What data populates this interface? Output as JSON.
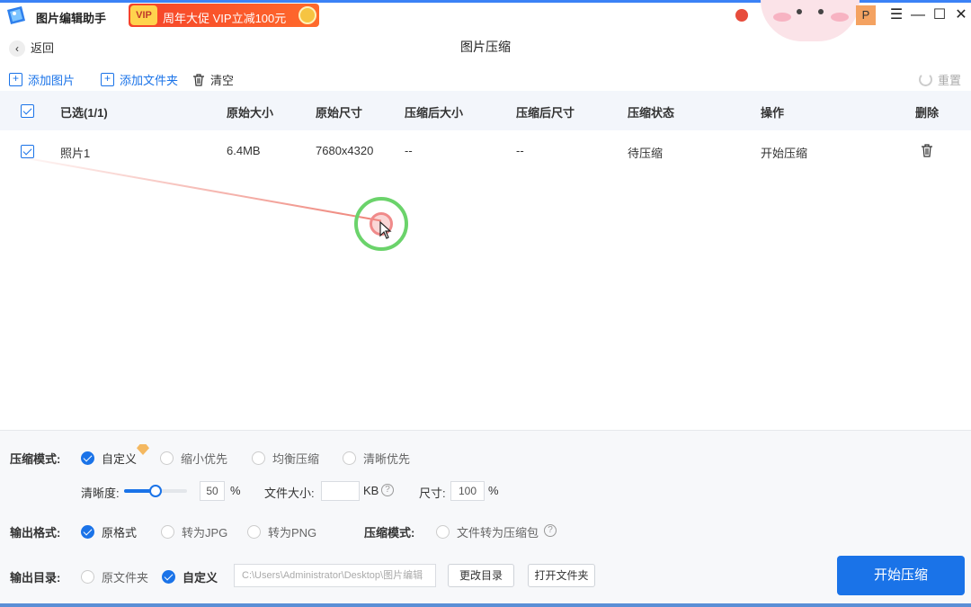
{
  "app": {
    "name": "图片编辑助手",
    "promo_badge": "VIP",
    "promo_text": "周年大促 VIP立减100元",
    "p_badge": "P"
  },
  "window_controls": {
    "menu": "☰",
    "minimize": "—",
    "maximize": "☐",
    "close": "✕"
  },
  "nav": {
    "back_label": "返回",
    "page_title": "图片压缩"
  },
  "toolbar": {
    "add_image": "添加图片",
    "add_folder": "添加文件夹",
    "clear": "清空",
    "reset": "重置"
  },
  "table": {
    "headers": {
      "selected": "已选(1/1)",
      "orig_size": "原始大小",
      "orig_dim": "原始尺寸",
      "comp_size": "压缩后大小",
      "comp_dim": "压缩后尺寸",
      "status": "压缩状态",
      "action": "操作",
      "delete": "删除"
    },
    "rows": [
      {
        "name": "照片1",
        "orig_size": "6.4MB",
        "orig_dim": "7680x4320",
        "comp_size": "--",
        "comp_dim": "--",
        "status": "待压缩",
        "action": "开始压缩"
      }
    ]
  },
  "settings": {
    "mode_label": "压缩模式:",
    "mode_options": [
      "自定义",
      "缩小优先",
      "均衡压缩",
      "清晰优先"
    ],
    "clarity_label": "清晰度:",
    "clarity_value": "50",
    "clarity_fraction": 0.5,
    "percent": "%",
    "filesize_label": "文件大小:",
    "filesize_value": "",
    "filesize_unit": "KB",
    "dim_label": "尺寸:",
    "dim_value": "100",
    "format_label": "输出格式:",
    "format_options": [
      "原格式",
      "转为JPG",
      "转为PNG"
    ],
    "mode2_label": "压缩模式:",
    "mode2_option": "文件转为压缩包",
    "output_label": "输出目录:",
    "output_options": [
      "原文件夹",
      "自定义"
    ],
    "output_path": "C:\\Users\\Administrator\\Desktop\\图片编辑",
    "change_dir": "更改目录",
    "open_folder": "打开文件夹",
    "start": "开始压缩",
    "help": "?"
  },
  "colors": {
    "accent": "#1a73e8",
    "promo": "#f5432a",
    "header_bg": "#f3f6fb"
  }
}
